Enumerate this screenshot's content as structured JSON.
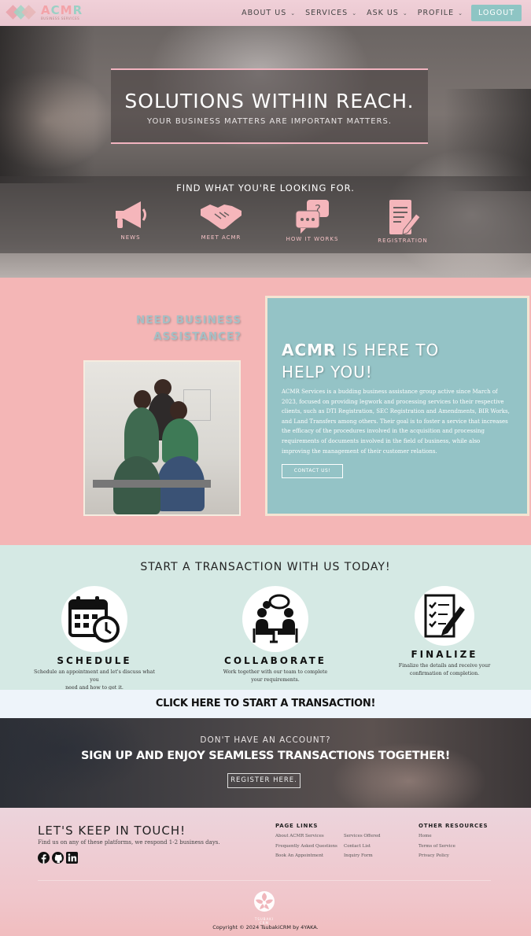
{
  "nav": {
    "logo_text": "ACMR",
    "logo_sub": "BUSINESS SERVICES",
    "items": [
      {
        "label": "ABOUT US",
        "has_dropdown": true
      },
      {
        "label": "SERVICES",
        "has_dropdown": true
      },
      {
        "label": "ASK US",
        "has_dropdown": true
      },
      {
        "label": "PROFILE",
        "has_dropdown": true
      }
    ],
    "logout_label": "LOGOUT"
  },
  "hero": {
    "title": "SOLUTIONS WITHIN REACH.",
    "subtitle": "YOUR BUSINESS MATTERS ARE IMPORTANT MATTERS.",
    "find_title": "FIND WHAT YOU'RE LOOKING FOR.",
    "quick_links": [
      {
        "label": "NEWS",
        "icon": "megaphone-icon"
      },
      {
        "label": "MEET ACMR",
        "icon": "handshake-icon"
      },
      {
        "label": "HOW IT WORKS",
        "icon": "chat-question-icon"
      },
      {
        "label": "REGISTRATION",
        "icon": "form-pen-icon"
      }
    ]
  },
  "about": {
    "need_line1": "NEED BUSINESS",
    "need_line2": "ASSISTANCE?",
    "heading_brand": "ACMR",
    "heading_rest1": " IS HERE TO",
    "heading_rest2": "HELP YOU!",
    "body": "ACMR Services is a budding business assistance group active since March of 2023, focused on providing legwork and processing services to their respective clients, such as DTI Registration, SEC Registration and Amendments, BIR Works, and Land Transfers among others. Their goal is to foster a service that increases the efficacy of the procedures involved in the acquisition and processing requirements of documents involved in the field of business, while also improving the management of their customer relations.",
    "contact_label": "CONTACT US!"
  },
  "start": {
    "title": "START A TRANSACTION WITH US TODAY!",
    "steps": [
      {
        "title": "SCHEDULE",
        "desc1": "Schedule an appointment and let's discuss what you",
        "desc2": "need and how to get it.",
        "icon": "calendar-clock-icon"
      },
      {
        "title": "COLLABORATE",
        "desc1": "Work together with our team to complete",
        "desc2": "your requirements.",
        "icon": "meeting-icon"
      },
      {
        "title": "FINALIZE",
        "desc1": "Finalize the details and receive your",
        "desc2": "confirmation of completion.",
        "icon": "checklist-pen-icon"
      }
    ]
  },
  "cta": {
    "label": "CLICK HERE TO START A TRANSACTION!"
  },
  "signup": {
    "question": "DON'T HAVE AN ACCOUNT?",
    "headline": "SIGN UP AND ENJOY SEAMLESS TRANSACTIONS TOGETHER!",
    "register_label": "REGISTER HERE."
  },
  "footer": {
    "title": "LET'S KEEP IN TOUCH!",
    "subtitle": "Find us on any of these platforms, we respond 1-2 business days.",
    "page_links_head": "PAGE LINKS",
    "page_links_col1": [
      "About ACMR Services",
      "Frequently Asked Questions",
      "Book An Appointment"
    ],
    "page_links_col2": [
      "Services Offered",
      "Contact List",
      "Inquiry Form"
    ],
    "other_head": "OTHER RESOURCES",
    "other_links": [
      "Home",
      "Terms of Service",
      "Privacy Policy"
    ],
    "logo_text": "TSUBAKI CRM",
    "copyright": "Copyright © 2024 TsubakiCRM by 4YAKA."
  },
  "colors": {
    "accent_teal": "#8ec5c4",
    "pink": "#f4b6b6",
    "mint": "#d5e9e4",
    "card_teal": "#94c3c6"
  }
}
